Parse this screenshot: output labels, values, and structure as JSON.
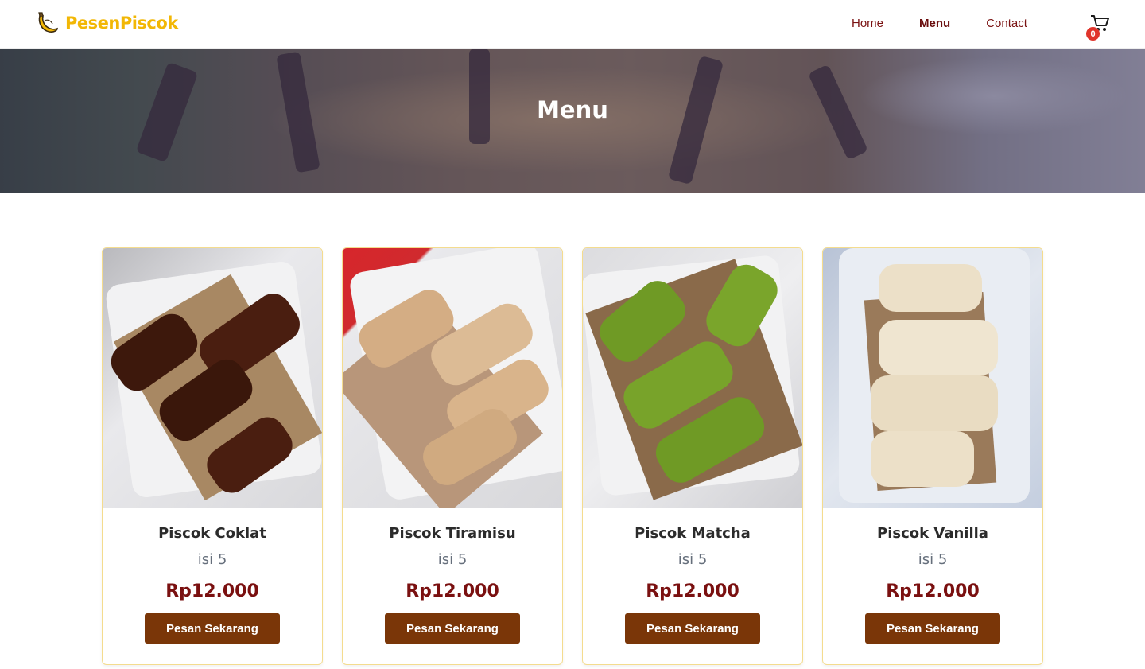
{
  "nav": {
    "brand": "PesenPiscok",
    "links": [
      {
        "label": "Home",
        "active": false
      },
      {
        "label": "Menu",
        "active": true
      },
      {
        "label": "Contact",
        "active": false
      }
    ],
    "cart_count": "0",
    "accent_color": "#f2b705",
    "link_color": "#7a1212"
  },
  "hero": {
    "title": "Menu"
  },
  "products": [
    {
      "name": "Piscok Coklat",
      "qty": "isi 5",
      "price": "Rp12.000",
      "button": "Pesan Sekarang",
      "topping_color": "#4a1e10"
    },
    {
      "name": "Piscok Tiramisu",
      "qty": "isi 5",
      "price": "Rp12.000",
      "button": "Pesan Sekarang",
      "topping_color": "#d9b48b"
    },
    {
      "name": "Piscok Matcha",
      "qty": "isi 5",
      "price": "Rp12.000",
      "button": "Pesan Sekarang",
      "topping_color": "#7aa52b"
    },
    {
      "name": "Piscok Vanilla",
      "qty": "isi 5",
      "price": "Rp12.000",
      "button": "Pesan Sekarang",
      "topping_color": "#ece0c8"
    }
  ],
  "colors": {
    "button_bg": "#7a3608",
    "price": "#7a1010",
    "card_border": "#f4dc8e",
    "badge": "#e0342b"
  }
}
